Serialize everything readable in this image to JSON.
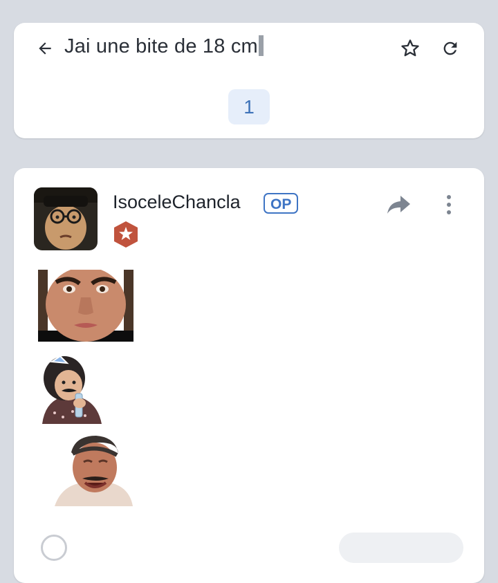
{
  "topic": {
    "title": "Jai une bite de 18 cm",
    "current_page": "1"
  },
  "icons": {
    "back": "arrow-left-icon",
    "favorite": "star-outline-icon",
    "refresh": "refresh-icon",
    "share": "share-arrow-icon",
    "more": "more-vertical-icon"
  },
  "post": {
    "author": "IsoceleChancla",
    "op_label": "OP",
    "rank_badge": "star-badge",
    "stickers": [
      "cristiano-face-sticker",
      "child-mustache-sticker",
      "laughing-man-sticker"
    ]
  },
  "colors": {
    "background": "#d7dbe2",
    "card": "#ffffff",
    "accent": "#3e74c4",
    "page_pill": "#e6eefa",
    "badge": "#c0533d"
  }
}
